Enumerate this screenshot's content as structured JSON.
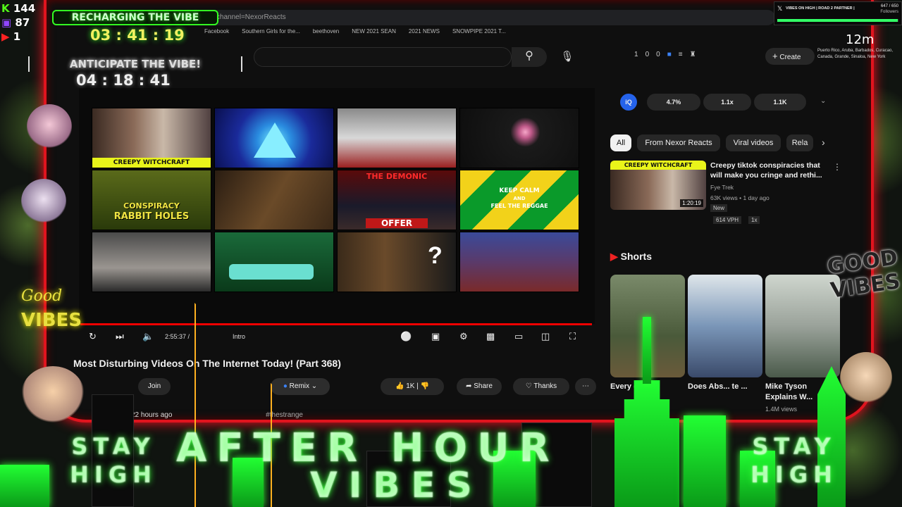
{
  "stats": {
    "kick": "144",
    "twitch": "87",
    "youtube": "1"
  },
  "timers": {
    "recharge_label": "RECHARGING THE VIBE",
    "recharge_time": "03 : 41 : 19",
    "anticipate_label": "ANTICIPATE THE VIBE!",
    "anticipate_time": "04 : 18 : 41"
  },
  "right_panel": {
    "channel_banner": "VIBES ON HIGH | ROAD 2 PARTNER |",
    "followers_value": "647 / 650",
    "followers_label": "Followers",
    "time_text": "12m",
    "locations": "Puerto Rico, Aruba, Barbados, Curacao, Canada, Grande, Sinaloa, New York"
  },
  "browser": {
    "url": "/@channel=NexorReacts",
    "bookmarks": [
      "Facebook",
      "Southern Girls for the...",
      "beethoven",
      "NEW 2021 SEAN",
      "2021 NEWS",
      "SNOWPIPE 2021 T..."
    ]
  },
  "youtube": {
    "create_label": "Create",
    "notif_counts": [
      "1",
      "0",
      "0"
    ],
    "thumb_captions": {
      "creepy": "CREEPY  WITCHCRAFT",
      "conspiracy": "CONSPIRACY",
      "rabbit": "RABBIT HOLES",
      "demonic": "THE DEMONIC",
      "offer": "OFFER",
      "keep_calm": "KEEP CALM",
      "and_label": "AND",
      "feel": "FEEL THE REGGAE"
    },
    "player": {
      "time": "2:55:37 /",
      "chapter": "Intro",
      "progress": 1.0
    },
    "video_title": "Most Disturbing Videos On The Internet Today! (Part 368)",
    "buttons": {
      "join": "Join",
      "remix": "Remix",
      "likes": "1K",
      "share": "Share",
      "thanks": "Thanks"
    },
    "meta": {
      "ago": "22 hours ago",
      "tags": "#thestrange"
    },
    "stats_pills": {
      "iq": "iQ",
      "p1": "4.7%",
      "p2": "1.1x",
      "p3": "1.1K"
    },
    "chips": [
      "All",
      "From Nexor Reacts",
      "Viral videos",
      "Rela"
    ],
    "rec": {
      "title": "Creepy tiktok conspiracies that will make you cringe and rethi...",
      "channel": "Fye Trek",
      "views": "63K views • 1 day ago",
      "badge": "New",
      "vph": "614 VPH",
      "mult": "1x",
      "duration": "1:20:19",
      "thumb_caption": "CREEPY  WITCHCRAFT"
    },
    "shorts_label": "Shorts",
    "shorts": [
      {
        "title": "Every cou..."
      },
      {
        "title": "Does Abs... te ..."
      },
      {
        "title": "Mike Tyson Explains W...",
        "views": "1.4M views"
      }
    ]
  },
  "overlay": {
    "good_vibes": "GOOD VIBES",
    "good": "Good",
    "vibes": "VIBES",
    "stay": "STAY",
    "high": "HIGH",
    "after_hour": "AFTER HOUR",
    "vibes_big": "VIBES"
  }
}
